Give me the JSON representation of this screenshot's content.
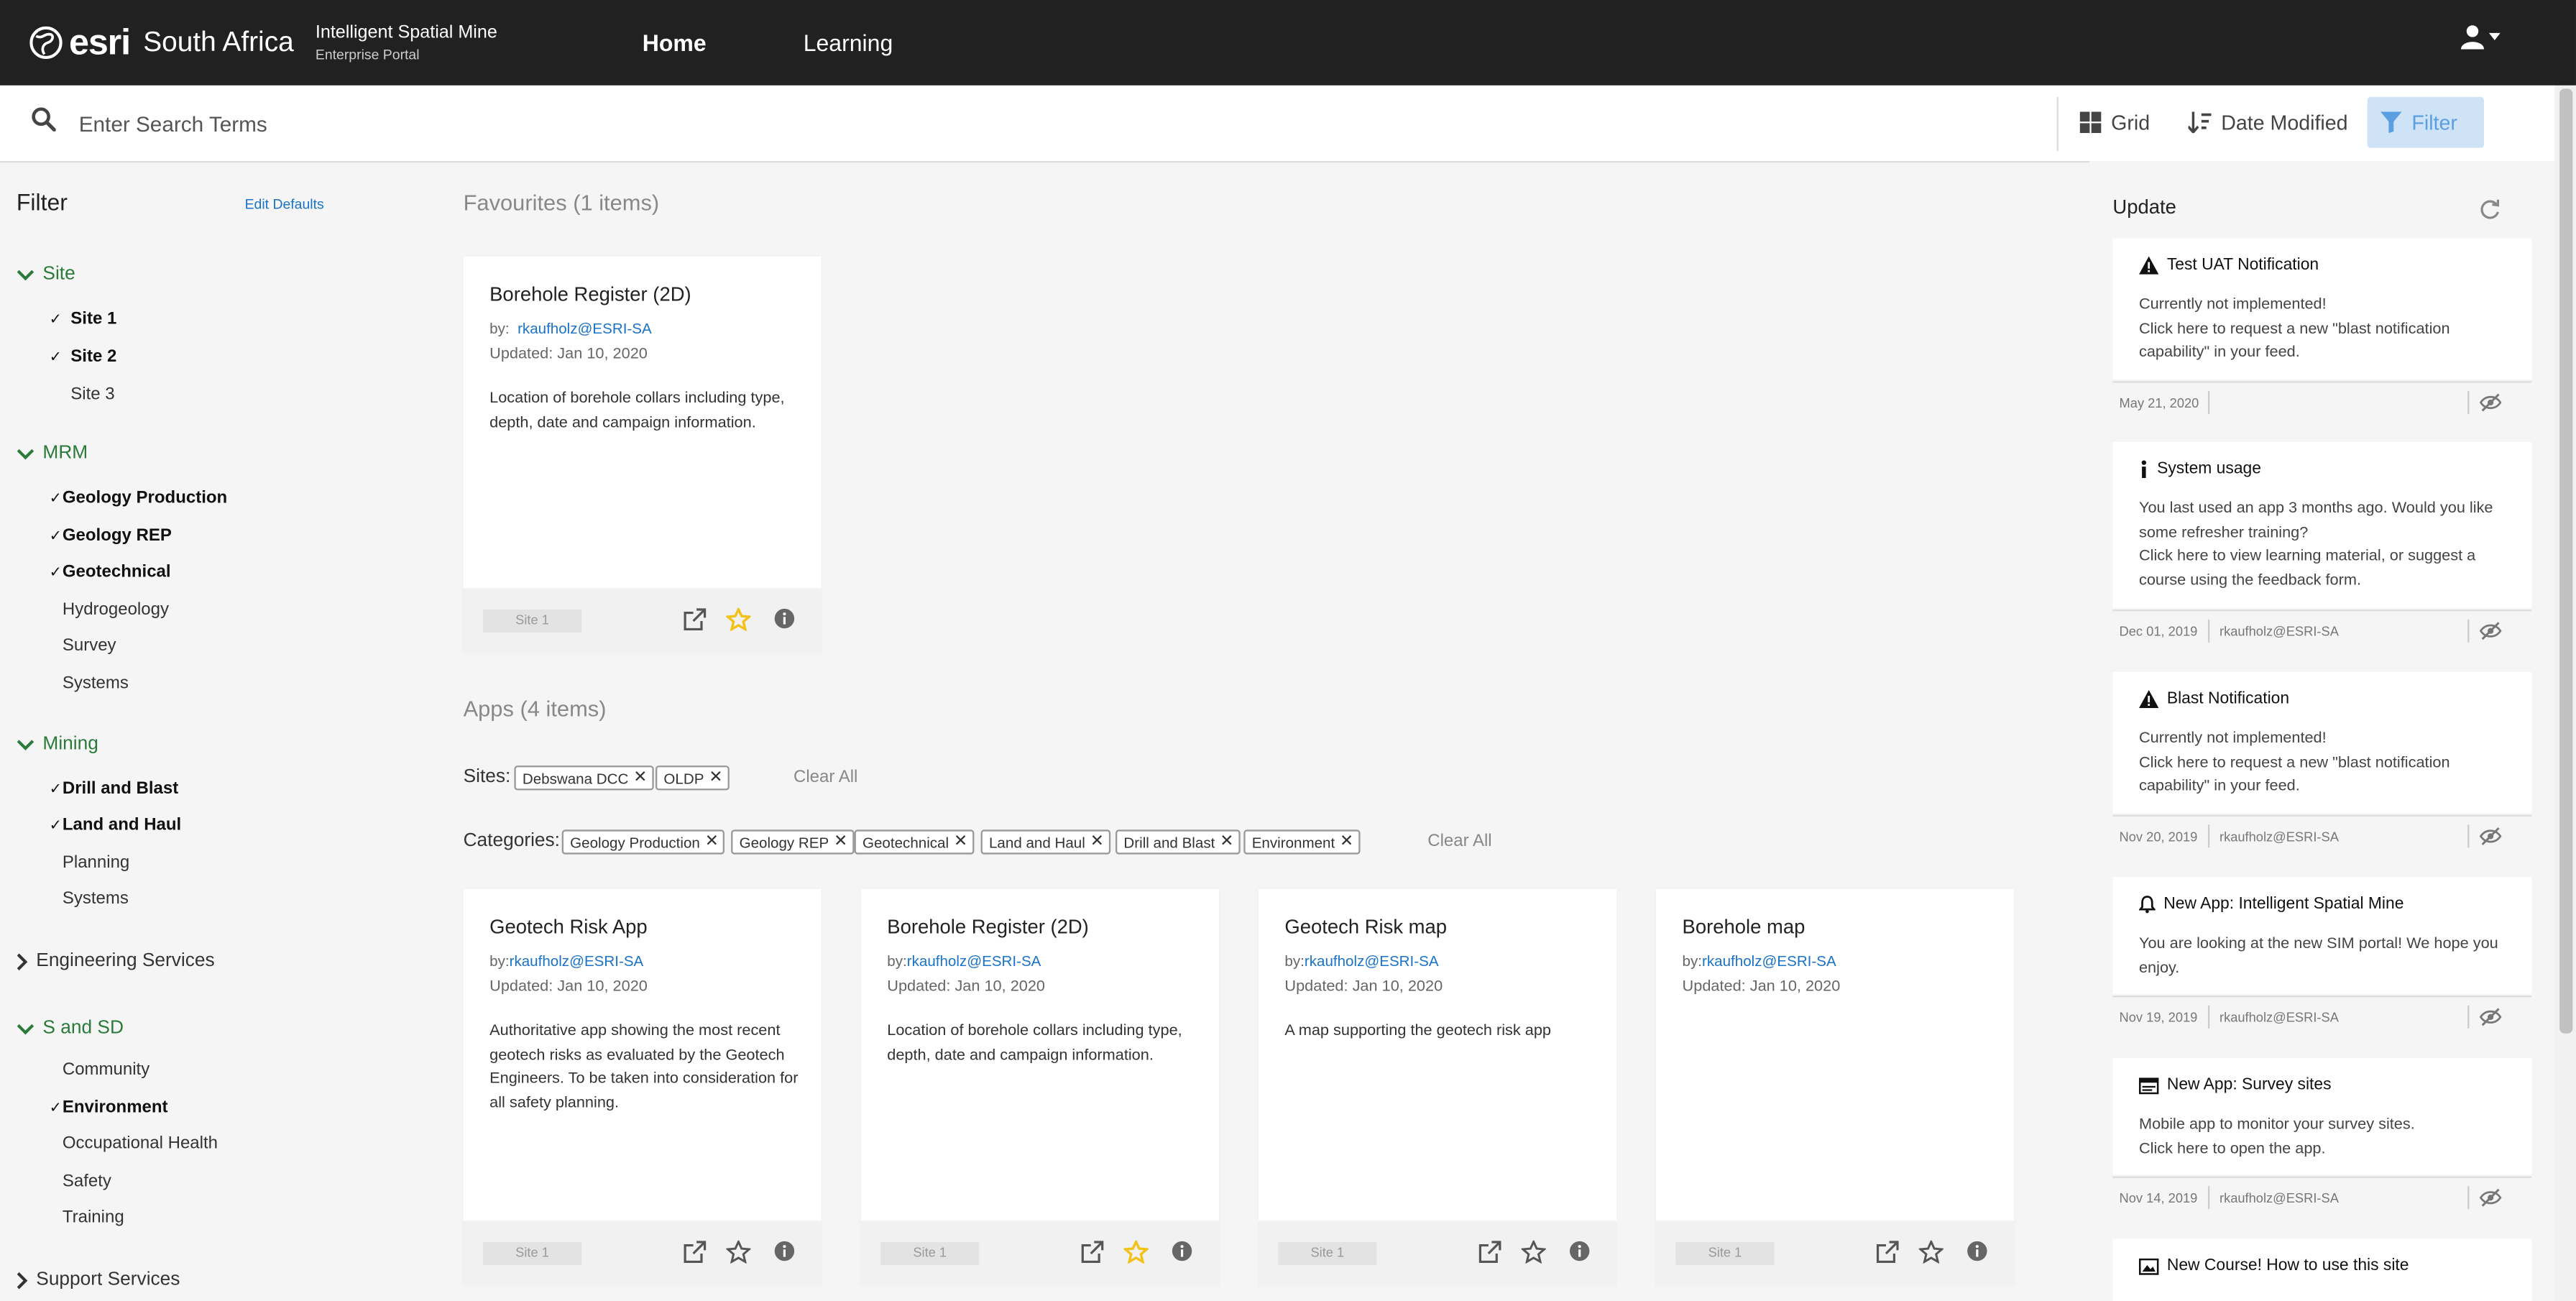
{
  "header": {
    "logo_brand": "esri",
    "logo_region": "South Africa",
    "app_title": "Intelligent Spatial Mine",
    "app_subtitle": "Enterprise Portal",
    "nav": [
      "Home",
      "Learning"
    ]
  },
  "search": {
    "placeholder": "Enter Search Terms"
  },
  "toolbar": {
    "grid_label": "Grid",
    "sort_label": "Date Modified",
    "filter_label": "Filter"
  },
  "sidebar": {
    "title": "Filter",
    "edit_defaults": "Edit Defaults",
    "groups": [
      {
        "name": "Site",
        "expanded": true,
        "items": [
          {
            "label": "Site 1",
            "checked": true
          },
          {
            "label": "Site 2",
            "checked": true
          },
          {
            "label": "Site 3",
            "checked": false
          }
        ]
      },
      {
        "name": "MRM",
        "expanded": true,
        "items": [
          {
            "label": "Geology Production",
            "checked": true
          },
          {
            "label": "Geology REP",
            "checked": true
          },
          {
            "label": "Geotechnical",
            "checked": true
          },
          {
            "label": "Hydrogeology",
            "checked": false
          },
          {
            "label": "Survey",
            "checked": false
          },
          {
            "label": "Systems",
            "checked": false
          }
        ]
      },
      {
        "name": "Mining",
        "expanded": true,
        "items": [
          {
            "label": "Drill and Blast",
            "checked": true
          },
          {
            "label": "Land and Haul",
            "checked": true
          },
          {
            "label": "Planning",
            "checked": false
          },
          {
            "label": "Systems",
            "checked": false
          }
        ]
      },
      {
        "name": "Engineering Services",
        "expanded": false,
        "items": []
      },
      {
        "name": "S and SD",
        "expanded": true,
        "items": [
          {
            "label": "Community",
            "checked": false
          },
          {
            "label": "Environment",
            "checked": true
          },
          {
            "label": "Occupational Health",
            "checked": false
          },
          {
            "label": "Safety",
            "checked": false
          },
          {
            "label": "Training",
            "checked": false
          }
        ]
      },
      {
        "name": "Support Services",
        "expanded": false,
        "items": []
      }
    ]
  },
  "favourites": {
    "title": "Favourites (1 items)",
    "cards": [
      {
        "title": "Borehole Register (2D)",
        "by_prefix": "by:",
        "author": "rkaufholz@ESRI-SA",
        "updated": "Updated: Jan 10, 2020",
        "description": "Location of borehole collars including type, depth, date and campaign information.",
        "site": "Site 1",
        "favourite": true
      }
    ]
  },
  "apps": {
    "title": "Apps (4 items)",
    "sites_label": "Sites:",
    "sites": [
      "Debswana DCC",
      "OLDP"
    ],
    "categories_label": "Categories:",
    "categories": [
      "Geology Production",
      "Geology REP",
      "Geotechnical",
      "Land and Haul",
      "Drill and Blast",
      "Environment"
    ],
    "clear_all": "Clear All",
    "cards": [
      {
        "title": "Geotech Risk App",
        "by_prefix": "by:",
        "author": "rkaufholz@ESRI-SA",
        "updated": "Updated: Jan 10, 2020",
        "description": "Authoritative app showing the most recent geotech risks as evaluated by the Geotech Engineers. To be taken into consideration for all safety planning.",
        "site": "Site 1",
        "favourite": false
      },
      {
        "title": "Borehole Register (2D)",
        "by_prefix": "by:",
        "author": "rkaufholz@ESRI-SA",
        "updated": "Updated: Jan 10, 2020",
        "description": "Location of borehole collars including type, depth, date and campaign information.",
        "site": "Site 1",
        "favourite": true
      },
      {
        "title": "Geotech Risk map",
        "by_prefix": "by:",
        "author": "rkaufholz@ESRI-SA",
        "updated": "Updated: Jan 10, 2020",
        "description": "A map supporting the geotech risk app",
        "site": "Site 1",
        "favourite": false
      },
      {
        "title": "Borehole map",
        "by_prefix": "by:",
        "author": "rkaufholz@ESRI-SA",
        "updated": "Updated: Jan 10, 2020",
        "description": "",
        "site": "Site 1",
        "favourite": false
      }
    ]
  },
  "updates": {
    "title": "Update",
    "items": [
      {
        "icon": "warning-icon",
        "title": "Test UAT Notification",
        "lines": [
          "Currently not implemented!",
          "Click here to request a new \"blast notification capability\" in your feed."
        ],
        "date": "May 21, 2020",
        "user": ""
      },
      {
        "icon": "info-icon",
        "title": "System usage",
        "lines": [
          "You last used an app 3 months ago. Would you like some refresher training?",
          "Click here to view learning material, or suggest a course using the feedback form."
        ],
        "date": "Dec 01, 2019",
        "user": "rkaufholz@ESRI-SA"
      },
      {
        "icon": "warning-icon",
        "title": "Blast Notification",
        "lines": [
          "Currently not implemented!",
          "Click here to request a new \"blast notification capability\" in your feed."
        ],
        "date": "Nov 20, 2019",
        "user": "rkaufholz@ESRI-SA"
      },
      {
        "icon": "bell-icon",
        "title": "New App: Intelligent Spatial Mine",
        "lines": [
          "You are looking at the new SIM portal! We hope you enjoy."
        ],
        "date": "Nov 19, 2019",
        "user": "rkaufholz@ESRI-SA"
      },
      {
        "icon": "app-icon",
        "title": "New App: Survey sites",
        "lines": [
          "Mobile app to monitor your survey sites.",
          "Click here to open the app."
        ],
        "date": "Nov 14, 2019",
        "user": "rkaufholz@ESRI-SA"
      },
      {
        "icon": "course-icon",
        "title": "New Course! How to use this site",
        "lines": [],
        "date": "",
        "user": ""
      }
    ]
  },
  "colors": {
    "topbar": "#212121",
    "accent_green": "#2a7a3a",
    "link_blue": "#1a73c8",
    "filter_active_bg": "#cfe3f7",
    "star_yellow": "#f2c21b"
  }
}
